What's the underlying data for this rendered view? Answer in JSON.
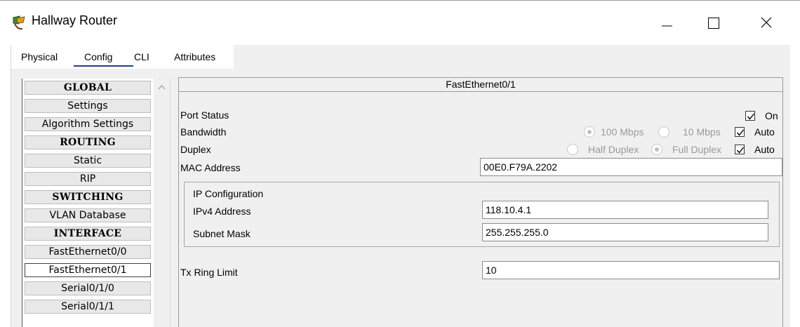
{
  "window": {
    "title": "Hallway Router",
    "icon": "router-icon"
  },
  "tabs": [
    {
      "label": "Physical",
      "active": false
    },
    {
      "label": "Config",
      "active": true
    },
    {
      "label": "CLI",
      "active": false
    },
    {
      "label": "Attributes",
      "active": false
    }
  ],
  "sidebar": {
    "items": [
      {
        "label": "GLOBAL",
        "type": "header"
      },
      {
        "label": "Settings",
        "type": "item"
      },
      {
        "label": "Algorithm Settings",
        "type": "item"
      },
      {
        "label": "ROUTING",
        "type": "header"
      },
      {
        "label": "Static",
        "type": "item"
      },
      {
        "label": "RIP",
        "type": "item"
      },
      {
        "label": "SWITCHING",
        "type": "header"
      },
      {
        "label": "VLAN Database",
        "type": "item"
      },
      {
        "label": "INTERFACE",
        "type": "header"
      },
      {
        "label": "FastEthernet0/0",
        "type": "item"
      },
      {
        "label": "FastEthernet0/1",
        "type": "item",
        "selected": true
      },
      {
        "label": "Serial0/1/0",
        "type": "item"
      },
      {
        "label": "Serial0/1/1",
        "type": "item"
      }
    ]
  },
  "panel": {
    "title": "FastEthernet0/1",
    "port_status": {
      "label": "Port Status",
      "on_label": "On",
      "on_checked": true
    },
    "bandwidth": {
      "label": "Bandwidth",
      "opt_100": "100 Mbps",
      "opt_10": "10 Mbps",
      "selected": "100 Mbps",
      "auto_label": "Auto",
      "auto_checked": true
    },
    "duplex": {
      "label": "Duplex",
      "opt_half": "Half Duplex",
      "opt_full": "Full Duplex",
      "selected": "Full Duplex",
      "auto_label": "Auto",
      "auto_checked": true
    },
    "mac": {
      "label": "MAC Address",
      "value": "00E0.F79A.2202"
    },
    "ip_config": {
      "heading": "IP Configuration",
      "ipv4_label": "IPv4 Address",
      "ipv4_value": "118.10.4.1",
      "mask_label": "Subnet Mask",
      "mask_value": "255.255.255.0"
    },
    "tx_ring": {
      "label": "Tx Ring Limit",
      "value": "10"
    }
  },
  "colors": {
    "config_underline": "#1e3f8f",
    "radio_disabled": "#c0c0c0",
    "disabled_text": "#9a9a9a"
  }
}
